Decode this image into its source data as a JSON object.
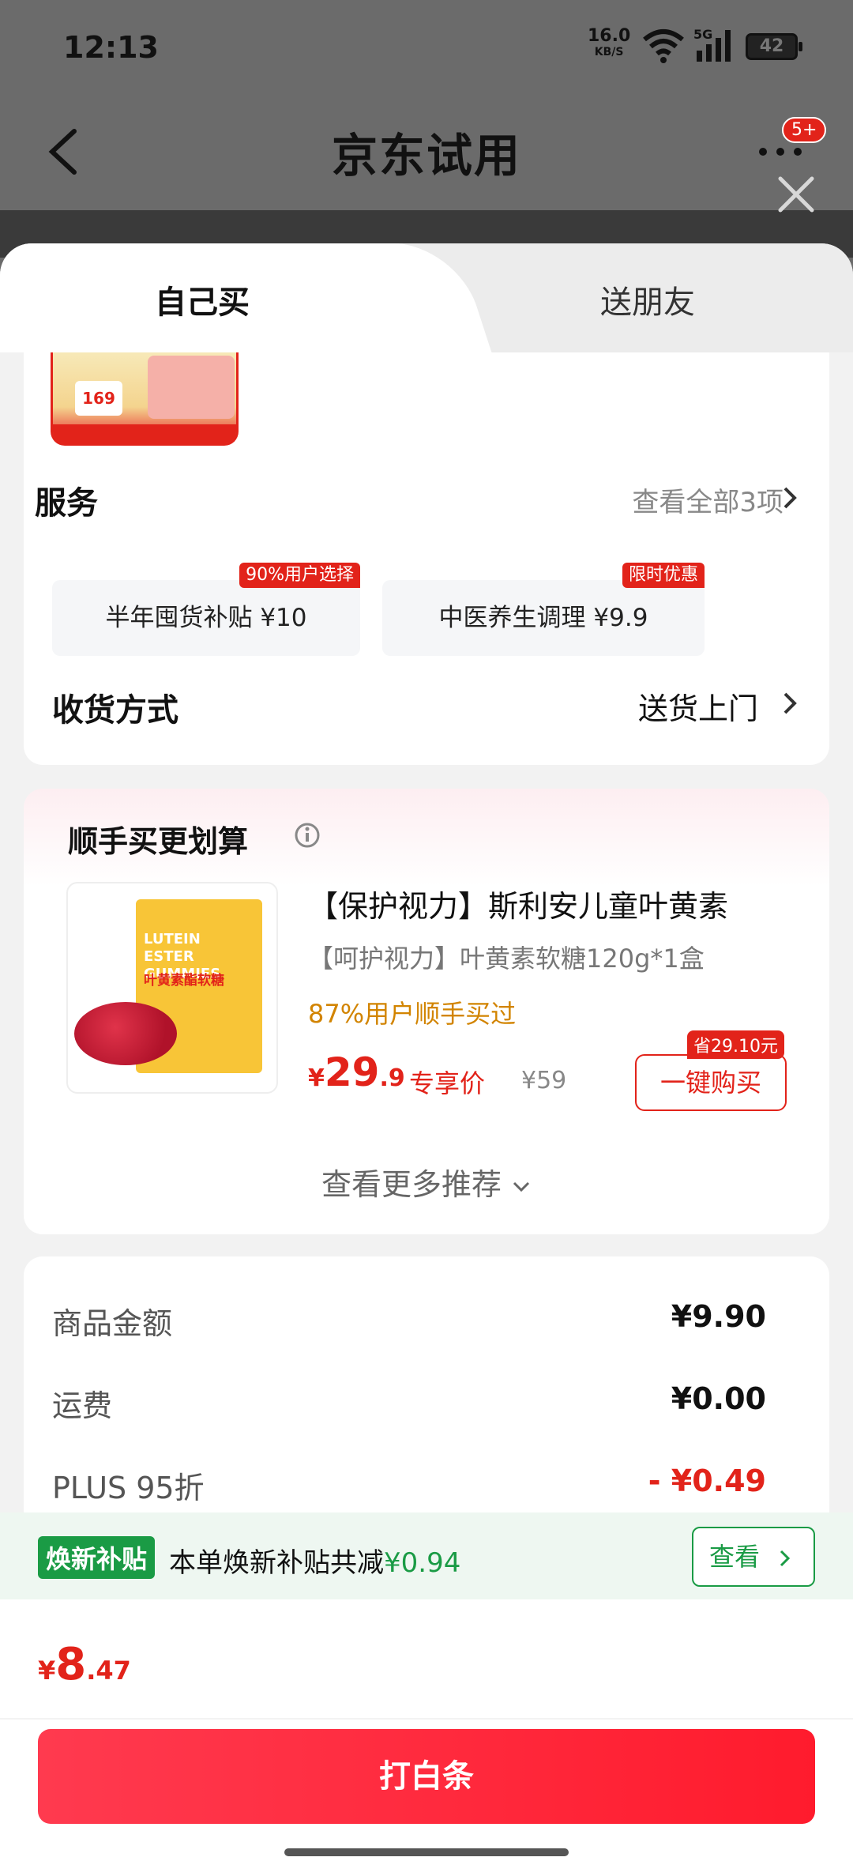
{
  "status_bar": {
    "time": "12:13",
    "net_speed": "16.0",
    "net_unit": "KB/S",
    "signal_label": "5G",
    "battery": "42"
  },
  "nav": {
    "title": "京东试用",
    "badge": "5+"
  },
  "tabs": [
    {
      "label": "自己买"
    },
    {
      "label": "送朋友"
    }
  ],
  "product_thumb": {
    "price": "169"
  },
  "service": {
    "title": "服务",
    "view_all": "查看全部3项",
    "items": [
      {
        "label": "半年囤货补贴  ¥10",
        "badge": "90%用户选择"
      },
      {
        "label": "中医养生调理  ¥9.9",
        "badge": "限时优惠"
      }
    ]
  },
  "delivery": {
    "title": "收货方式",
    "value": "送货上门"
  },
  "recommend": {
    "title": "顺手买更划算",
    "product": {
      "name": "【保护视力】斯利安儿童叶黄素",
      "sub": "【呵护视力】叶黄素软糖120g*1盒",
      "buyers_pct": "87%用户顺手买过",
      "price_currency": "¥",
      "price_int": "29",
      "price_dec": ".9",
      "exclusive_label": "专享价",
      "original_price": "¥59",
      "save_badge": "省29.10元",
      "buy_label": "一键购买",
      "box_text": "LUTEIN ESTER GUMMIES",
      "box_text_cn": "叶黄素酯软糖"
    },
    "more_label": "查看更多推荐"
  },
  "summary": {
    "rows": [
      {
        "label": "商品金额",
        "value": "¥9.90"
      },
      {
        "label": "运费",
        "value": "¥0.00"
      },
      {
        "label": "PLUS 95折",
        "value": "- ¥0.49"
      }
    ]
  },
  "subsidy": {
    "tag": "焕新补贴",
    "text": "本单焕新补贴共减",
    "amount": "¥0.94",
    "button": "查看"
  },
  "footer": {
    "currency": "¥",
    "total_int": "8",
    "total_dec": ".47",
    "pay_label": "打白条"
  },
  "colors": {
    "accent": "#e2231a",
    "green": "#1a9b45",
    "orange": "#d28400"
  }
}
